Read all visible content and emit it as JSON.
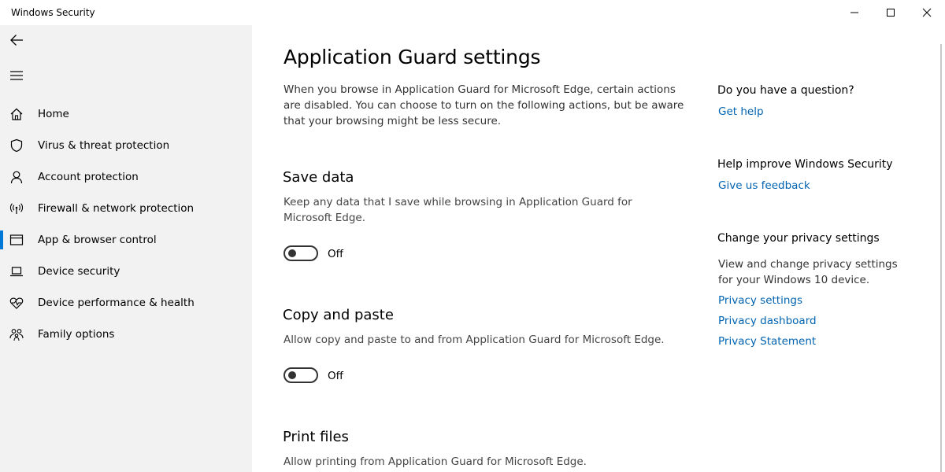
{
  "window": {
    "title": "Windows Security"
  },
  "sidebar": {
    "items": [
      {
        "label": "Home",
        "icon": "home-icon"
      },
      {
        "label": "Virus & threat protection",
        "icon": "shield-icon"
      },
      {
        "label": "Account protection",
        "icon": "person-icon"
      },
      {
        "label": "Firewall & network protection",
        "icon": "antenna-icon"
      },
      {
        "label": "App & browser control",
        "icon": "browser-window-icon",
        "active": true
      },
      {
        "label": "Device security",
        "icon": "laptop-icon"
      },
      {
        "label": "Device performance & health",
        "icon": "heart-pulse-icon"
      },
      {
        "label": "Family options",
        "icon": "family-icon"
      }
    ]
  },
  "main": {
    "title": "Application Guard settings",
    "intro": "When you browse in Application Guard for Microsoft Edge, certain actions are disabled. You can choose to turn on the following actions, but be aware that your browsing might be less secure.",
    "sections": [
      {
        "title": "Save data",
        "desc": "Keep any data that I save while browsing in Application Guard for Microsoft Edge.",
        "toggle": "Off"
      },
      {
        "title": "Copy and paste",
        "desc": "Allow copy and paste to and from Application Guard for Microsoft Edge.",
        "toggle": "Off"
      },
      {
        "title": "Print files",
        "desc": "Allow printing from Application Guard for Microsoft Edge."
      }
    ]
  },
  "aside": {
    "question_title": "Do you have a question?",
    "get_help": "Get help",
    "improve_title": "Help improve Windows Security",
    "feedback": "Give us feedback",
    "privacy_title": "Change your privacy settings",
    "privacy_text": "View and change privacy settings for your Windows 10 device.",
    "privacy_settings": "Privacy settings",
    "privacy_dashboard": "Privacy dashboard",
    "privacy_statement": "Privacy Statement"
  },
  "colors": {
    "accent": "#0078d7",
    "link": "#0063b1",
    "sidebar_bg": "#f2f2f2"
  }
}
